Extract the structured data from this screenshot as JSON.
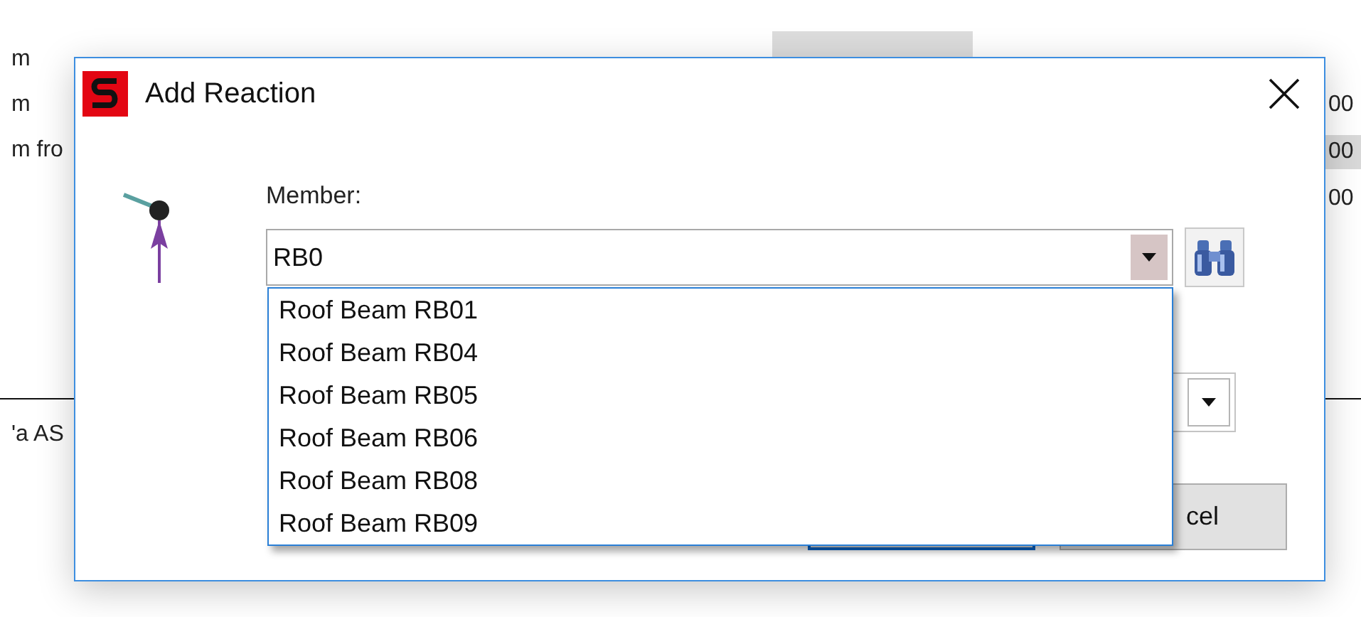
{
  "background": {
    "left_texts": [
      "m",
      "m",
      "m fro",
      "'a AS"
    ],
    "right_texts": [
      {
        "text": "00",
        "selected": false
      },
      {
        "text": "00",
        "selected": true
      },
      {
        "text": "00",
        "selected": false
      }
    ]
  },
  "dialog": {
    "title": "Add Reaction",
    "member": {
      "label": "Member:",
      "value": "RB0",
      "expanded": true,
      "options": [
        {
          "label": "Roof Beam RB01",
          "selected": false
        },
        {
          "label": "Roof Beam RB04",
          "selected": false
        },
        {
          "label": "Roof Beam RB05",
          "selected": false
        },
        {
          "label": "Roof Beam RB06",
          "selected": false
        },
        {
          "label": "Roof Beam RB08",
          "selected": false
        },
        {
          "label": "Roof Beam RB09",
          "selected": false
        }
      ]
    },
    "buttons": [
      {
        "kind": "primary"
      },
      {
        "kind": "cancel",
        "label": "cel"
      }
    ]
  }
}
